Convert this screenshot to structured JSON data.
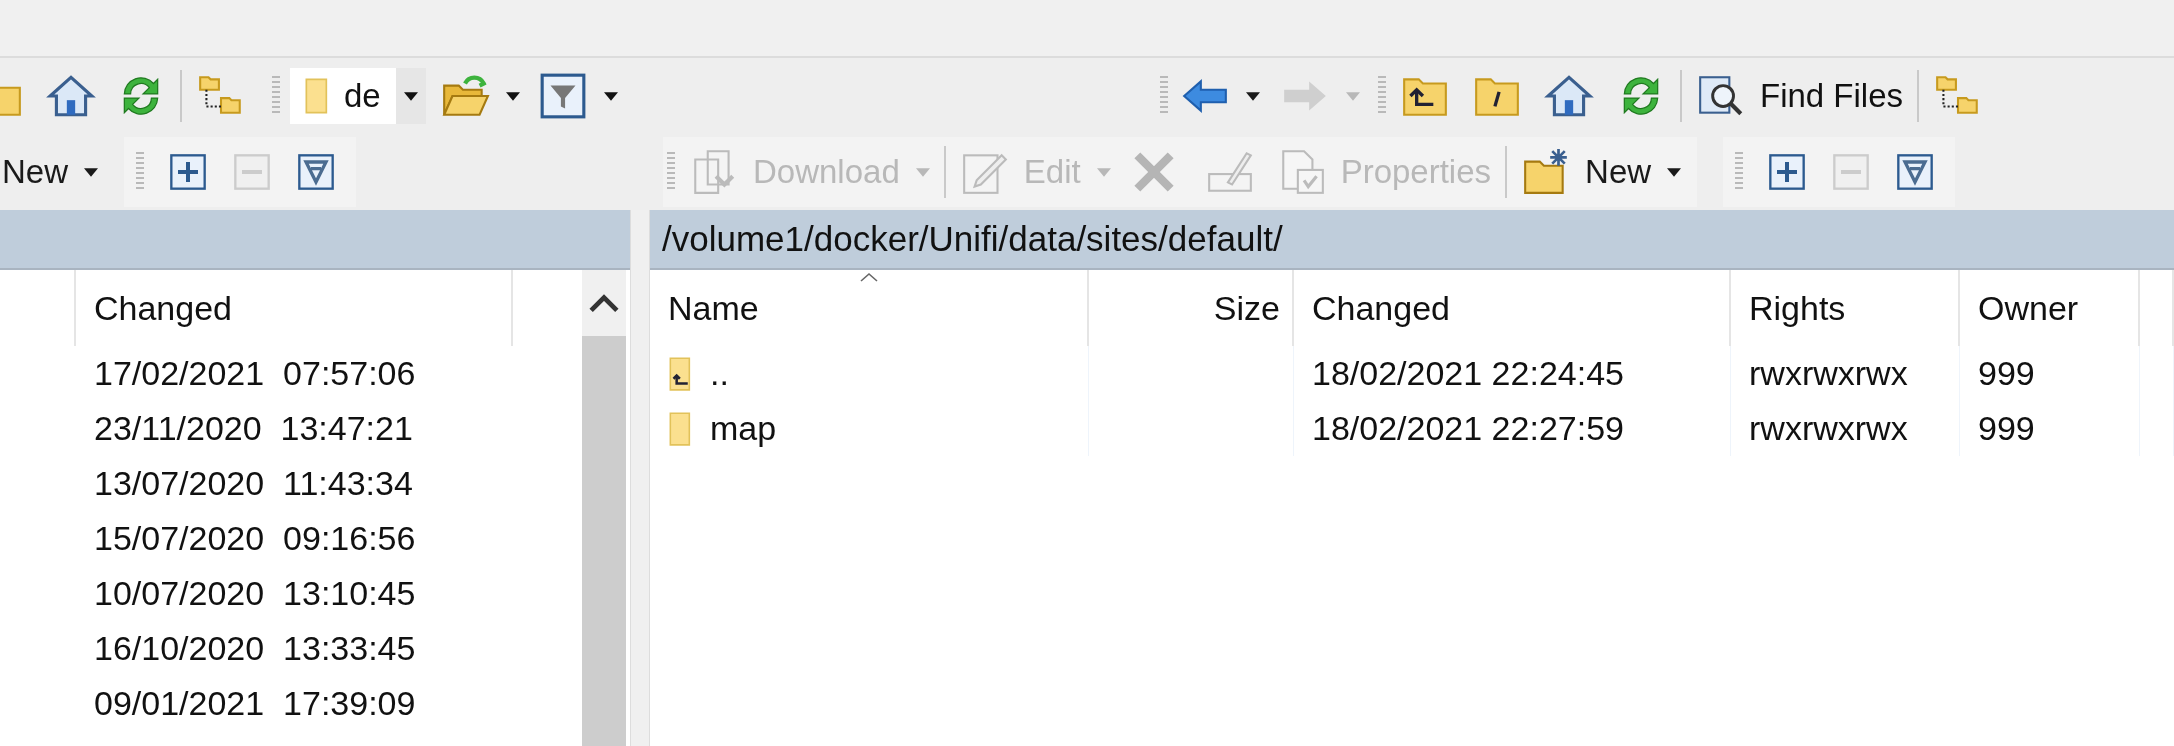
{
  "left_toolbar": {
    "path_combo": {
      "value": "de"
    },
    "new": {
      "label": "New",
      "disabled": false
    },
    "select": {
      "disabled": false
    },
    "unselect": {
      "disabled": true
    },
    "invert": {
      "disabled": false
    }
  },
  "right_toolbar": {
    "back": {
      "disabled": false
    },
    "forward": {
      "disabled": true
    },
    "find_files": {
      "label": "Find Files"
    },
    "download": {
      "label": "Download",
      "disabled": true
    },
    "edit": {
      "label": "Edit",
      "disabled": true
    },
    "delete": {
      "disabled": true
    },
    "rename": {
      "disabled": true
    },
    "properties": {
      "label": "Properties",
      "disabled": true
    },
    "new": {
      "label": "New",
      "disabled": false
    },
    "select": {
      "disabled": false
    },
    "unselect": {
      "disabled": true
    },
    "invert": {
      "disabled": false
    }
  },
  "left_panel": {
    "columns": [
      {
        "label": "Changed"
      }
    ],
    "rows": [
      {
        "changed": "17/02/2021  07:57:06"
      },
      {
        "changed": "23/11/2020  13:47:21"
      },
      {
        "changed": "13/07/2020  11:43:34"
      },
      {
        "changed": "15/07/2020  09:16:56"
      },
      {
        "changed": "10/07/2020  13:10:45"
      },
      {
        "changed": "16/10/2020  13:33:45"
      },
      {
        "changed": "09/01/2021  17:39:09"
      }
    ]
  },
  "right_panel": {
    "path": "/volume1/docker/Unifi/data/sites/default/",
    "columns": [
      {
        "label": "Name",
        "sorted": true
      },
      {
        "label": "Size",
        "sorted": false
      },
      {
        "label": "Changed",
        "sorted": false
      },
      {
        "label": "Rights",
        "sorted": false
      },
      {
        "label": "Owner",
        "sorted": false
      }
    ],
    "rows": [
      {
        "kind": "parent",
        "name": "..",
        "changed": "18/02/2021 22:24:45",
        "rights": "rwxrwxrwx",
        "owner": "999"
      },
      {
        "kind": "folder",
        "name": "map",
        "changed": "18/02/2021 22:27:59",
        "rights": "rwxrwxrwx",
        "owner": "999"
      }
    ]
  }
}
